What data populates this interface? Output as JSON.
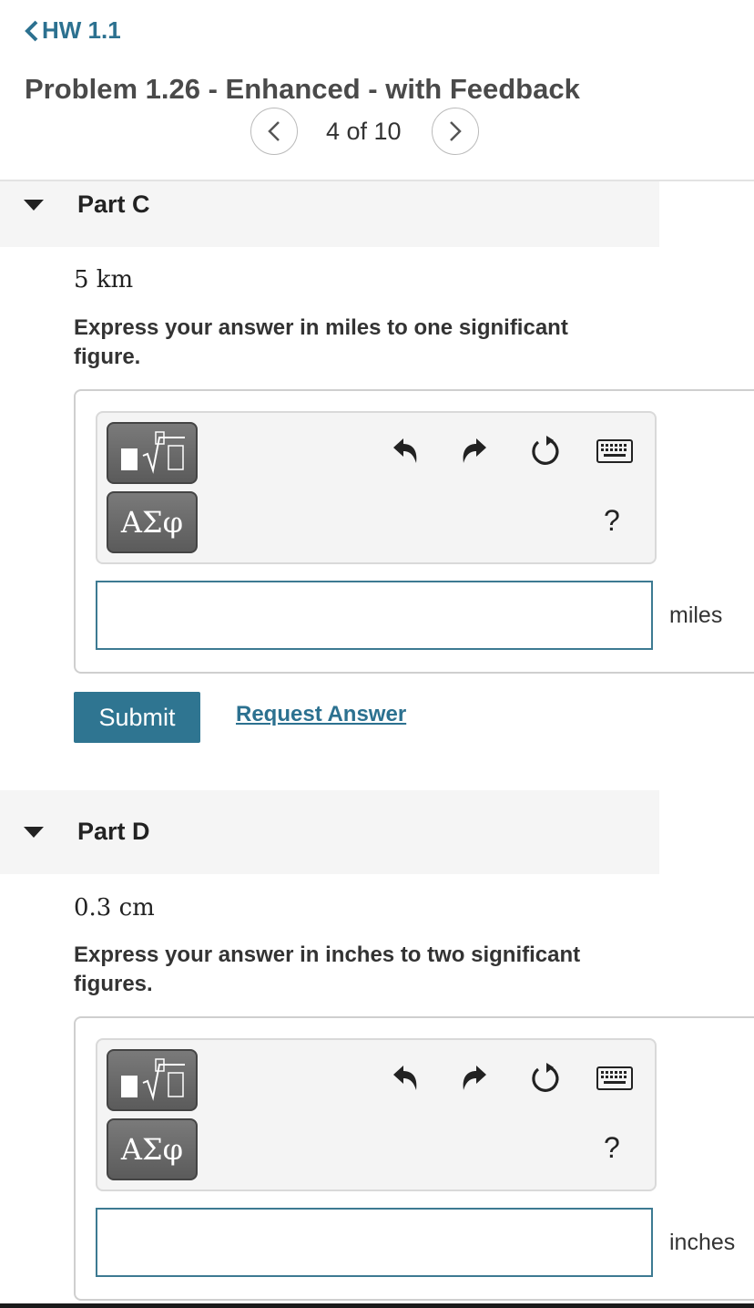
{
  "header": {
    "back_label": "HW 1.1",
    "problem_title": "Problem 1.26 - Enhanced - with Feedback",
    "page_indicator": "4 of 10"
  },
  "parts": [
    {
      "title": "Part C",
      "quantity": "5 km",
      "instruction_line1": "Express your answer in miles to one significant",
      "instruction_line2": "figure.",
      "input_value": "",
      "unit": "miles"
    },
    {
      "title": "Part D",
      "quantity": "0.3 cm",
      "instruction_line1": "Express your answer in inches to two significant",
      "instruction_line2": "figures.",
      "input_value": "",
      "unit": "inches"
    }
  ],
  "toolbar": {
    "greek_label": "ΑΣφ",
    "help_label": "?"
  },
  "actions": {
    "submit_label": "Submit",
    "request_answer_label": "Request Answer"
  },
  "colors": {
    "accent": "#2c7190",
    "submit_bg": "#2f7591",
    "part_header_bg": "#f5f5f5"
  }
}
